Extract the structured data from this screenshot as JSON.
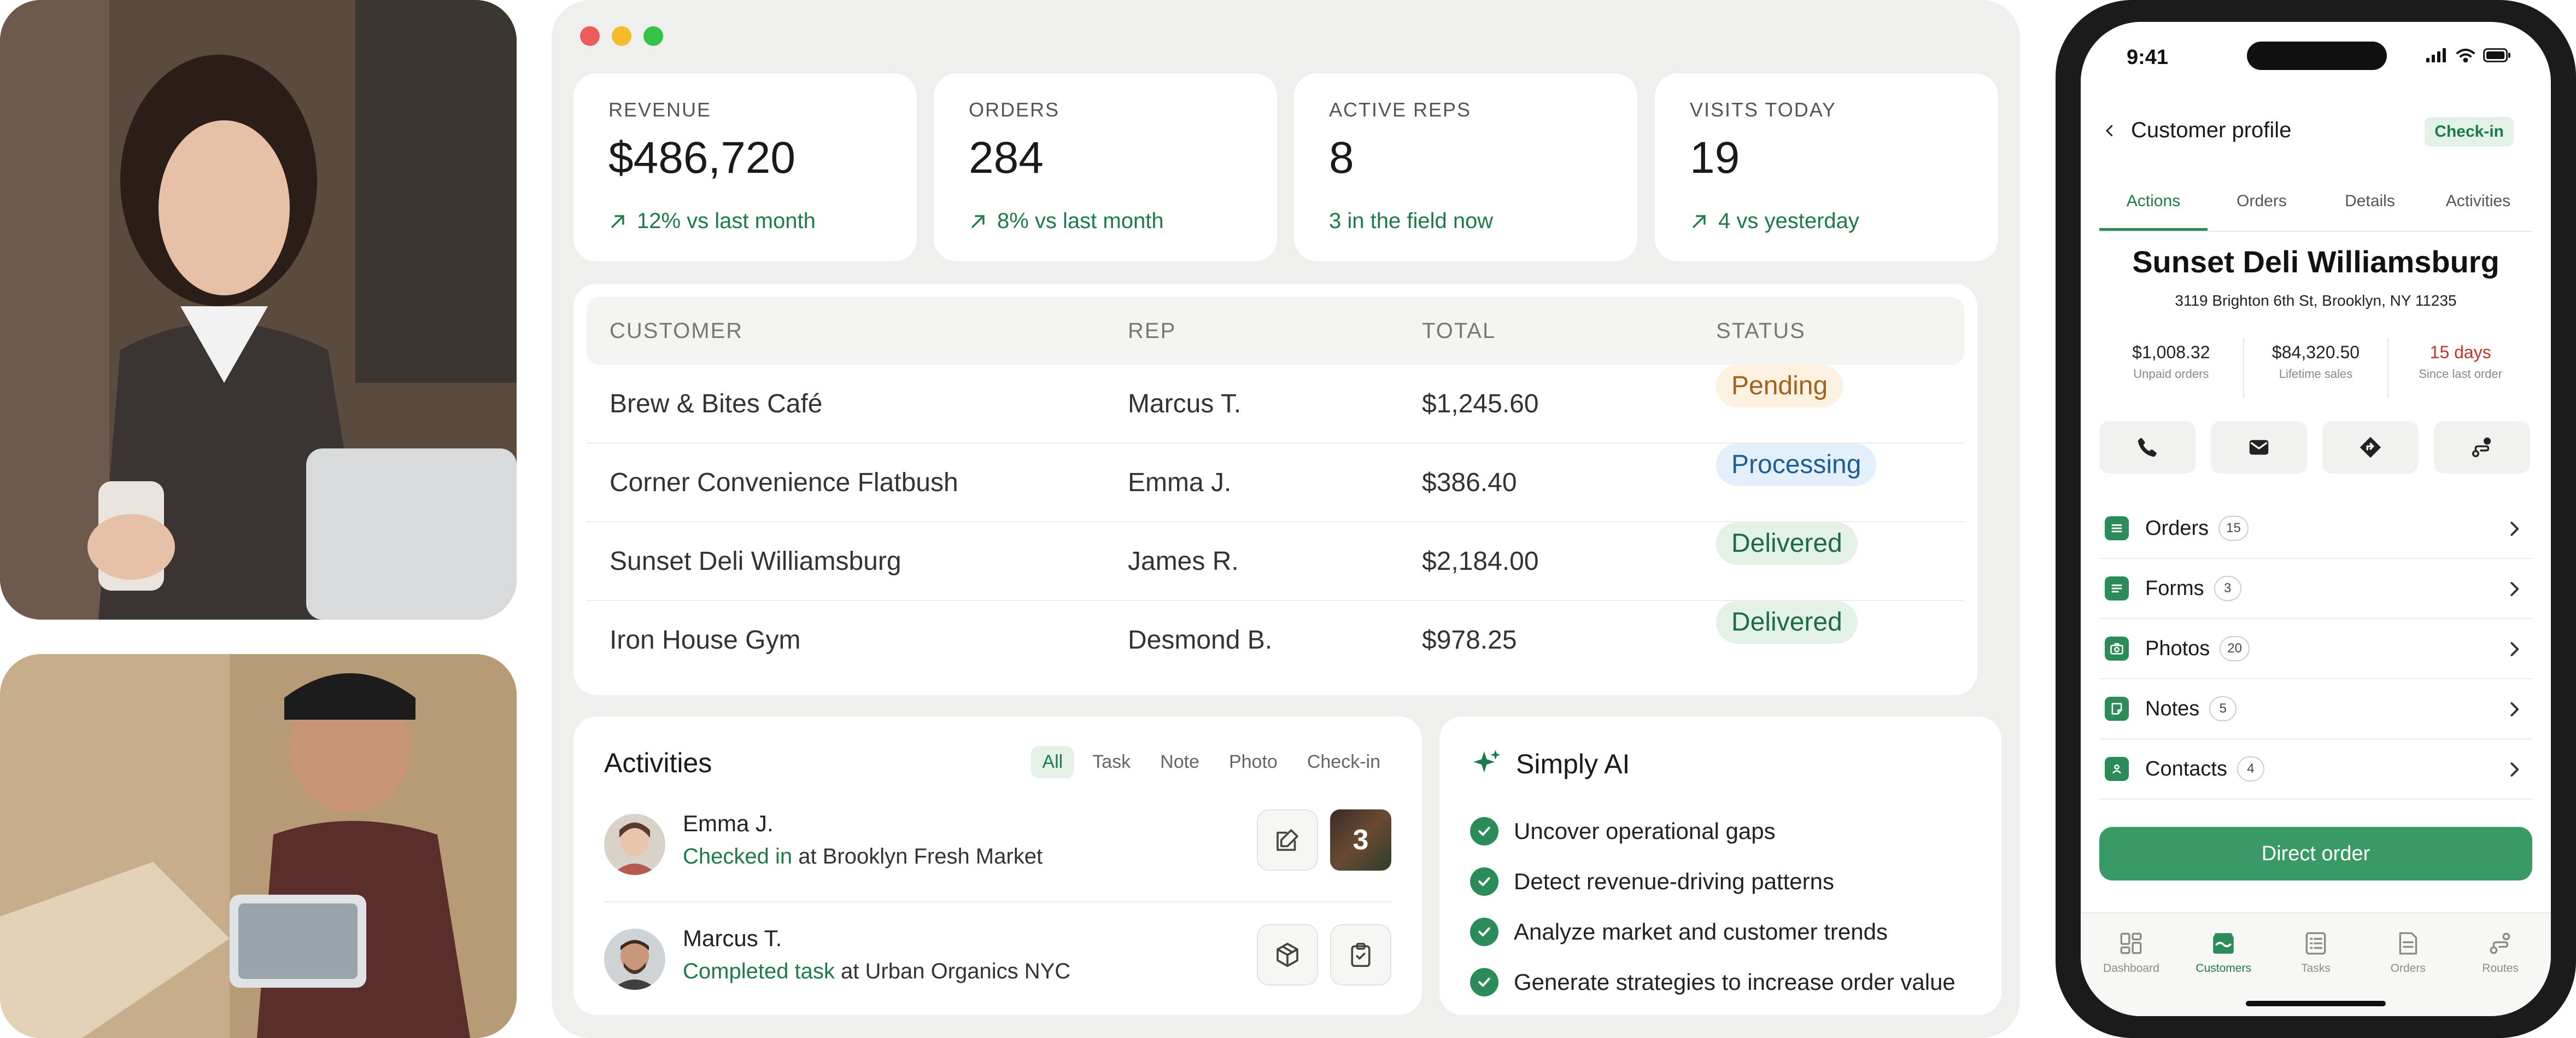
{
  "brand": {
    "accent": "#2c8c59",
    "accent_text": "#1d7a4a",
    "accent_soft": "#e3f1e6",
    "alert": "#c0342a"
  },
  "kpis": [
    {
      "label": "REVENUE",
      "value": "$486,720",
      "delta": "12% vs last month",
      "arrow": true
    },
    {
      "label": "ORDERS",
      "value": "284",
      "delta": "8% vs last month",
      "arrow": true
    },
    {
      "label": "ACTIVE REPS",
      "value": "8",
      "delta": "3 in the field now",
      "arrow": false
    },
    {
      "label": "VISITS TODAY",
      "value": "19",
      "delta": "4 vs yesterday",
      "arrow": true
    }
  ],
  "orders_table": {
    "headers": [
      "CUSTOMER",
      "REP",
      "TOTAL",
      "STATUS"
    ],
    "rows": [
      {
        "customer": "Brew & Bites Café",
        "rep": "Marcus T.",
        "total": "$1,245.60",
        "status": "Pending"
      },
      {
        "customer": "Corner Convenience Flatbush",
        "rep": "Emma J.",
        "total": "$386.40",
        "status": "Processing"
      },
      {
        "customer": "Sunset Deli Williamsburg",
        "rep": "James R.",
        "total": "$2,184.00",
        "status": "Delivered"
      },
      {
        "customer": "Iron House Gym",
        "rep": "Desmond B.",
        "total": "$978.25",
        "status": "Delivered"
      }
    ],
    "status_colors": {
      "Pending": {
        "bg": "#fdf1e1",
        "fg": "#a4621a"
      },
      "Processing": {
        "bg": "#e3f0fb",
        "fg": "#1f5e93"
      },
      "Delivered": {
        "bg": "#e3f1e6",
        "fg": "#1d6b40"
      }
    }
  },
  "activities": {
    "title": "Activities",
    "filters": [
      "All",
      "Task",
      "Note",
      "Photo",
      "Check-in"
    ],
    "active_filter": "All",
    "items": [
      {
        "name": "Emma J.",
        "verb": "Checked in",
        "rest": " at Brooklyn Fresh Market",
        "thumb_count": "3"
      },
      {
        "name": "Marcus T.",
        "verb": "Completed task",
        "rest": " at Urban Organics NYC"
      }
    ]
  },
  "ai": {
    "title": "Simply AI",
    "items": [
      "Uncover operational gaps",
      "Detect revenue-driving patterns",
      "Analyze market and customer trends",
      "Generate strategies to increase order value"
    ]
  },
  "phone": {
    "time": "9:41",
    "header": "Customer profile",
    "checkin": "Check-in",
    "tabs": [
      "Actions",
      "Orders",
      "Details",
      "Activities"
    ],
    "active_tab": "Actions",
    "customer_name": "Sunset Deli Williamsburg",
    "address": "3119 Brighton 6th St, Brooklyn, NY 11235",
    "stats": [
      {
        "value": "$1,008.32",
        "label": "Unpaid orders"
      },
      {
        "value": "$84,320.50",
        "label": "Lifetime sales"
      },
      {
        "value": "15 days",
        "label": "Since last order"
      }
    ],
    "quick_actions": [
      "phone-icon",
      "mail-icon",
      "directions-icon",
      "route-icon"
    ],
    "menu": [
      {
        "label": "Orders",
        "count": "15",
        "icon": "list-icon"
      },
      {
        "label": "Forms",
        "count": "3",
        "icon": "form-icon"
      },
      {
        "label": "Photos",
        "count": "20",
        "icon": "camera-icon"
      },
      {
        "label": "Notes",
        "count": "5",
        "icon": "note-icon"
      },
      {
        "label": "Contacts",
        "count": "4",
        "icon": "contact-icon"
      }
    ],
    "cta": "Direct order",
    "tabbar": [
      {
        "label": "Dashboard",
        "icon": "dashboard-icon"
      },
      {
        "label": "Customers",
        "icon": "store-icon"
      },
      {
        "label": "Tasks",
        "icon": "tasks-icon"
      },
      {
        "label": "Orders",
        "icon": "orders-icon"
      },
      {
        "label": "Routes",
        "icon": "routes-icon"
      }
    ],
    "active_tabbar": "Customers"
  }
}
